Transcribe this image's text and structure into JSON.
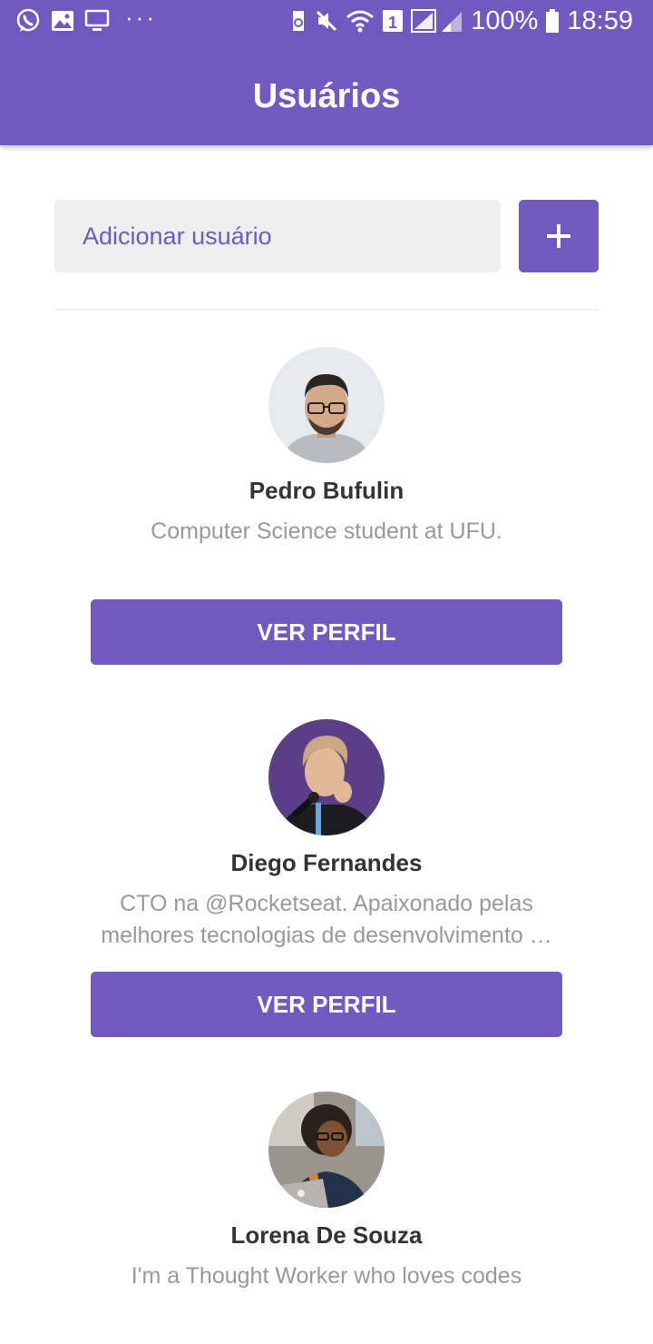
{
  "status_bar": {
    "battery": "100%",
    "time": "18:59",
    "sim_label": "1",
    "left_icons": [
      "whatsapp-icon",
      "image-icon",
      "monitor-icon"
    ],
    "right_icons": [
      "recycle-icon",
      "mute-icon",
      "wifi-icon",
      "sim-icon",
      "signal-icon",
      "battery-icon"
    ]
  },
  "header": {
    "title": "Usuários"
  },
  "form": {
    "placeholder": "Adicionar usuário",
    "add_icon": "plus-icon"
  },
  "users": [
    {
      "name": "Pedro Bufulin",
      "bio": "Computer Science student at UFU.",
      "button": "VER PERFIL"
    },
    {
      "name": "Diego Fernandes",
      "bio": "CTO na @Rocketseat. Apaixonado pelas melhores tecnologias de desenvolvimento …",
      "button": "VER PERFIL"
    },
    {
      "name": "Lorena De Souza",
      "bio": "I'm a Thought Worker who loves codes"
    }
  ],
  "colors": {
    "primary": "#7159c1",
    "input_bg": "#eeeeee",
    "name_text": "#333333",
    "bio_text": "#999999"
  }
}
